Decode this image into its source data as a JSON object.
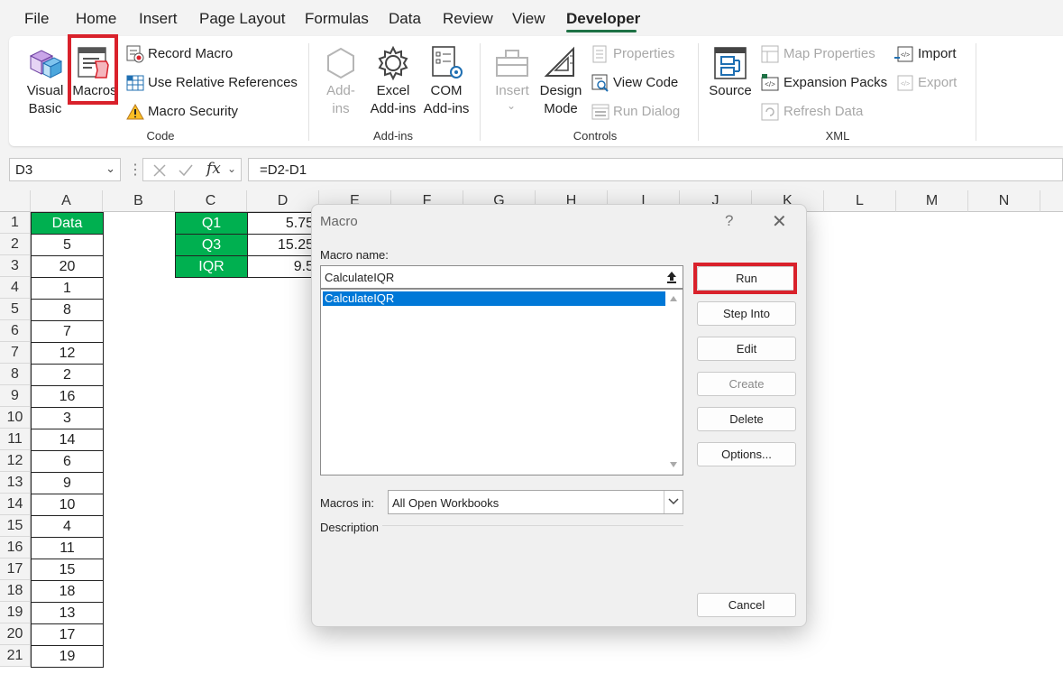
{
  "menu": {
    "items": [
      "File",
      "Home",
      "Insert",
      "Page Layout",
      "Formulas",
      "Data",
      "Review",
      "View",
      "Developer"
    ],
    "active": "Developer"
  },
  "ribbon": {
    "code": {
      "visual_basic": "Visual\nBasic",
      "macros": "Macros",
      "record_macro": "Record Macro",
      "use_relative": "Use Relative References",
      "macro_security": "Macro Security",
      "label": "Code"
    },
    "addins": {
      "addins": "Add-\nins",
      "excel_addins": "Excel\nAdd-ins",
      "com_addins": "COM\nAdd-ins",
      "label": "Add-ins"
    },
    "controls": {
      "insert": "Insert",
      "design_mode": "Design\nMode",
      "properties": "Properties",
      "view_code": "View Code",
      "run_dialog": "Run Dialog",
      "label": "Controls"
    },
    "xml": {
      "source": "Source",
      "map_properties": "Map Properties",
      "expansion_packs": "Expansion Packs",
      "refresh_data": "Refresh Data",
      "import": "Import",
      "export": "Export",
      "label": "XML"
    }
  },
  "formula_bar": {
    "name_box": "D3",
    "formula": "=D2-D1"
  },
  "sheet": {
    "columns": [
      "A",
      "B",
      "C",
      "D",
      "E",
      "F",
      "G",
      "H",
      "I",
      "J",
      "K",
      "L",
      "M",
      "N"
    ],
    "rows": [
      "1",
      "2",
      "3",
      "4",
      "5",
      "6",
      "7",
      "8",
      "9",
      "10",
      "11",
      "12",
      "13",
      "14",
      "15",
      "16",
      "17",
      "18",
      "19",
      "20",
      "21"
    ],
    "col_a": [
      "Data",
      "5",
      "20",
      "1",
      "8",
      "7",
      "12",
      "2",
      "16",
      "3",
      "14",
      "6",
      "9",
      "10",
      "4",
      "11",
      "15",
      "18",
      "13",
      "17",
      "19"
    ],
    "col_c": [
      "Q1",
      "Q3",
      "IQR"
    ],
    "col_d": [
      "5.75",
      "15.25",
      "9.5"
    ]
  },
  "dialog": {
    "title": "Macro",
    "help": "?",
    "macro_name_label": "Macro name:",
    "macro_name_value": "CalculateIQR",
    "macros_list": [
      "CalculateIQR"
    ],
    "macros_in_label": "Macros in:",
    "macros_in_value": "All Open Workbooks",
    "description_label": "Description",
    "buttons": {
      "run": "Run",
      "step_into": "Step Into",
      "edit": "Edit",
      "create": "Create",
      "delete": "Delete",
      "options": "Options...",
      "cancel": "Cancel"
    }
  },
  "colors": {
    "accent_green": "#1e7145",
    "cell_green": "#00b050",
    "highlight_red": "#d9212b",
    "selection_blue": "#0078d7"
  }
}
